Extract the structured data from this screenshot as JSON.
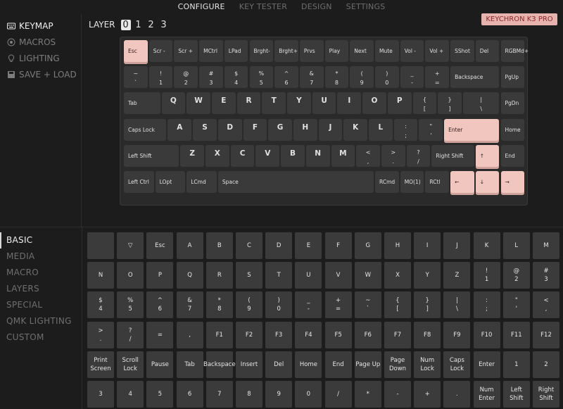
{
  "topnav": [
    "CONFIGURE",
    "KEY TESTER",
    "DESIGN",
    "SETTINGS"
  ],
  "topnav_active": 0,
  "sidebar": [
    {
      "label": "KEYMAP",
      "icon": "keyboard-icon",
      "active": true
    },
    {
      "label": "MACROS",
      "icon": "macro-icon",
      "active": false
    },
    {
      "label": "LIGHTING",
      "icon": "bulb-icon",
      "active": false
    },
    {
      "label": "SAVE + LOAD",
      "icon": "save-icon",
      "active": false
    }
  ],
  "layers": {
    "label": "LAYER",
    "options": [
      "0",
      "1",
      "2",
      "3"
    ],
    "selected": "0"
  },
  "device": "KEYCHRON K3 PRO",
  "keyboard": {
    "row0": [
      "Esc",
      "Scr -",
      "Scr +",
      "MCtrl",
      "LPad",
      "Brght-",
      "Brght+",
      "Prvs",
      "Play",
      "Next",
      "Mute",
      "Vol -",
      "Vol +",
      "SShot",
      "Del",
      "RGBMd+"
    ],
    "row1": [
      "~\n`",
      "!\n1",
      "@\n2",
      "#\n3",
      "$\n4",
      "%\n5",
      "^\n6",
      "&\n7",
      "*\n8",
      "(\n9",
      ")\n0",
      "_\n-",
      "+\n=",
      "Backspace",
      "PgUp"
    ],
    "row2": [
      "Tab",
      "Q",
      "W",
      "E",
      "R",
      "T",
      "Y",
      "U",
      "I",
      "O",
      "P",
      "{\n[",
      "}\n]",
      "|\n\\",
      "PgDn"
    ],
    "row3": [
      "Caps Lock",
      "A",
      "S",
      "D",
      "F",
      "G",
      "H",
      "J",
      "K",
      "L",
      ":\n;",
      "\"\n'",
      "Enter",
      "Home"
    ],
    "row4": [
      "Left Shift",
      "Z",
      "X",
      "C",
      "V",
      "B",
      "N",
      "M",
      "<\n,",
      ">\n.",
      "?\n/",
      "Right Shift",
      "↑",
      "End"
    ],
    "row5": [
      "Left Ctrl",
      "LOpt",
      "LCmd",
      "Space",
      "RCmd",
      "MO(1)",
      "RCtl",
      "←",
      "↓",
      "→"
    ]
  },
  "categories": [
    "BASIC",
    "MEDIA",
    "MACRO",
    "LAYERS",
    "SPECIAL",
    "QMK LIGHTING",
    "CUSTOM"
  ],
  "categories_active": 0,
  "basic_keys": [
    [
      "",
      "▽",
      "Esc",
      "A",
      "B",
      "C",
      "D",
      "E",
      "F",
      "G",
      "H",
      "I",
      "J",
      "K",
      "L",
      "M"
    ],
    [
      "N",
      "O",
      "P",
      "Q",
      "R",
      "S",
      "T",
      "U",
      "V",
      "W",
      "X",
      "Y",
      "Z",
      "!\n1",
      "@\n2",
      "#\n3"
    ],
    [
      "$\n4",
      "%\n5",
      "^\n6",
      "&\n7",
      "*\n8",
      "(\n9",
      ")\n0",
      "_\n-",
      "+\n=",
      "~\n`",
      "{\n[",
      "}\n]",
      "|\n\\",
      ":\n;",
      "\"\n'",
      "<\n,"
    ],
    [
      ">\n.",
      "?\n/",
      "=",
      ",",
      "F1",
      "F2",
      "F3",
      "F4",
      "F5",
      "F6",
      "F7",
      "F8",
      "F9",
      "F10",
      "F11",
      "F12"
    ],
    [
      "Print\nScreen",
      "Scroll\nLock",
      "Pause",
      "Tab",
      "Backspace",
      "Insert",
      "Del",
      "Home",
      "End",
      "Page Up",
      "Page\nDown",
      "Num\nLock",
      "Caps\nLock",
      "Enter",
      "1",
      "2"
    ],
    [
      "3",
      "4",
      "5",
      "6",
      "7",
      "8",
      "9",
      "0",
      "/",
      "*",
      "-",
      "+",
      ".",
      "Num\nEnter",
      "Left\nShift",
      "Right\nShift"
    ]
  ],
  "colors": {
    "accent": "#f0c6bf",
    "badge_bg": "#e6b3ae",
    "badge_text": "#8a2a2a",
    "background": "#1c1c1c"
  }
}
